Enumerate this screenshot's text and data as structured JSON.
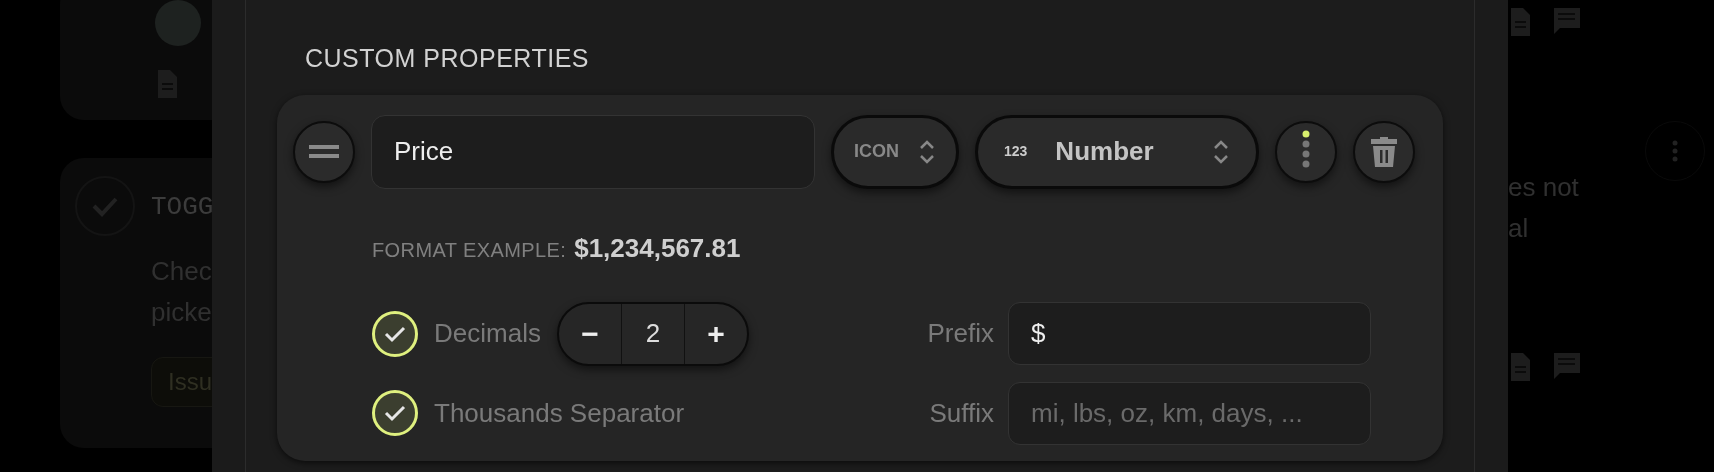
{
  "background": {
    "left_card": {
      "label": "TOGG",
      "lines": [
        "Chec",
        "picke"
      ],
      "tag": "Issu"
    },
    "right_card": {
      "lines": [
        "es not",
        "al"
      ]
    }
  },
  "modal": {
    "section_title": "CUSTOM PROPERTIES",
    "property": {
      "name": "Price",
      "icon_select": "ICON",
      "type_badge": "123",
      "type": "Number",
      "format_label": "FORMAT EXAMPLE:",
      "format_example": "$1,234,567.81",
      "options": [
        {
          "kind": "stepper",
          "label": "Decimals",
          "checked": true,
          "value": "2",
          "minus": "−",
          "plus": "+"
        },
        {
          "kind": "plain",
          "label": "Thousands Separator",
          "checked": true
        }
      ],
      "fields": [
        {
          "label": "Prefix",
          "value": "$"
        },
        {
          "label": "Suffix",
          "placeholder": "mi, lbs, oz, km, days, ..."
        }
      ]
    }
  }
}
